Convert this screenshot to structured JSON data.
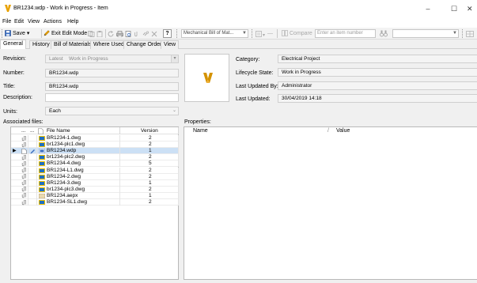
{
  "window": {
    "title": "BR1234.wdp - Work in Progress - Item",
    "minimize": "–",
    "maximize": "☐",
    "close": "✕"
  },
  "menu": [
    "File",
    "Edit",
    "View",
    "Actions",
    "Help"
  ],
  "toolbar": {
    "save_label": "Save",
    "save_dropdown": "▾",
    "exit_edit_label": "Exit Edit Mode",
    "help_label": "?",
    "mechanical_bill": "Mechanical Bill of Mat...",
    "compare_label": "Compare",
    "item_number_placeholder": "Enter an item number"
  },
  "tabs": [
    "General",
    "History",
    "Bill of Materials",
    "Where Used",
    "Change Order",
    "View"
  ],
  "form": {
    "revision_label": "Revision:",
    "revision_value": "Latest",
    "revision_state": "Work in Progress",
    "number_label": "Number:",
    "number_value": "BR1234.wdp",
    "title_label": "Title:",
    "title_value": "BR1234.wdp",
    "description_label": "Description:",
    "description_value": "",
    "units_label": "Units:",
    "units_value": "Each",
    "associated_files_label": "Associated files:"
  },
  "info": {
    "category_label": "Category:",
    "category_value": "Electrical Project",
    "lifecycle_label": "Lifecycle State:",
    "lifecycle_value": "Work in Progress",
    "last_updated_by_label": "Last Updated By:",
    "last_updated_by_value": "Administrator",
    "last_updated_label": "Last Updated:",
    "last_updated_value": "30/04/2019 14:18"
  },
  "files_table": {
    "columns": [
      "...",
      "...",
      "File Name",
      "Version"
    ],
    "rows": [
      {
        "name": "BR1234-1.dwg",
        "version": "2",
        "type": "dwg"
      },
      {
        "name": "br1234-plc1.dwg",
        "version": "2",
        "type": "dwg"
      },
      {
        "name": "BR1234.wdp",
        "version": "1",
        "type": "wdp",
        "selected": true
      },
      {
        "name": "br1234-plc2.dwg",
        "version": "2",
        "type": "dwg"
      },
      {
        "name": "BR1234-4.dwg",
        "version": "5",
        "type": "dwg"
      },
      {
        "name": "BR1234-L1.dwg",
        "version": "2",
        "type": "dwg"
      },
      {
        "name": "BR1234-2.dwg",
        "version": "2",
        "type": "dwg"
      },
      {
        "name": "BR1234-3.dwg",
        "version": "1",
        "type": "dwg"
      },
      {
        "name": "br1234-plc3.dwg",
        "version": "2",
        "type": "dwg"
      },
      {
        "name": "BR1234.aepx",
        "version": "1",
        "type": "aepx"
      },
      {
        "name": "BR1234-SL1.dwg",
        "version": "2",
        "type": "dwg"
      }
    ]
  },
  "properties": {
    "label": "Properties:",
    "col_name": "Name",
    "col_sort": "/",
    "col_value": "Value"
  },
  "colors": {
    "accent": "#e8a100",
    "selected_row": "#cce0f5",
    "dwg_icon": "#f0c000"
  }
}
